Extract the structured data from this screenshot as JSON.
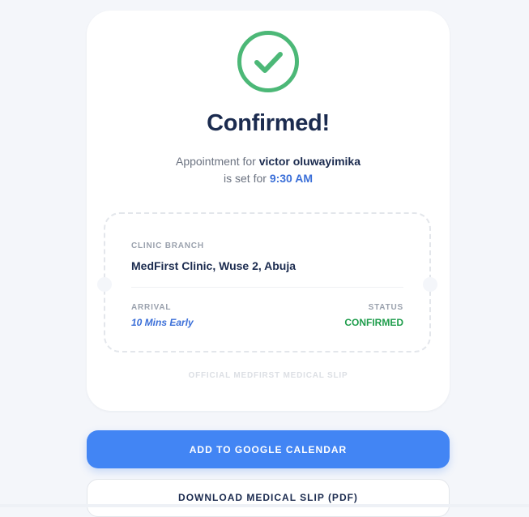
{
  "confirmation": {
    "title": "Confirmed!",
    "line1_prefix": "Appointment for ",
    "patient_name": "victor oluwayimika",
    "line2_prefix": "is set for ",
    "time": "9:30 AM"
  },
  "slip": {
    "branch_label": "CLINIC BRANCH",
    "branch_value": "MedFirst Clinic, Wuse 2, Abuja",
    "arrival_label": "ARRIVAL",
    "arrival_value": "10 Mins Early",
    "status_label": "STATUS",
    "status_value": "CONFIRMED",
    "footnote": "OFFICIAL MEDFIRST MEDICAL SLIP"
  },
  "actions": {
    "calendar_label": "ADD TO GOOGLE CALENDAR",
    "download_label": "DOWNLOAD MEDICAL SLIP (PDF)"
  },
  "icons": {
    "success": "check-circle-icon"
  },
  "colors": {
    "success_green": "#4cb877",
    "primary_blue": "#4285f4",
    "title_navy": "#1b2b4f",
    "status_green": "#1f9d4c",
    "accent_blue": "#3b6fd8"
  }
}
